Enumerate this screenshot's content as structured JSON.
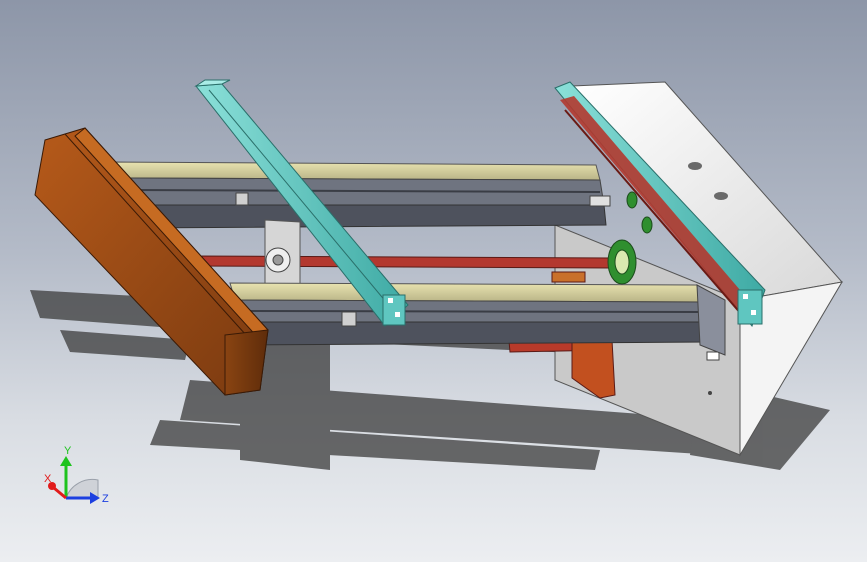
{
  "viewport": {
    "background_top": "#8d96a8",
    "background_bottom": "#eceef1"
  },
  "colors": {
    "wood_beam": "#9a4a14",
    "guide_plate": "#5fc6c0",
    "rail_steel": "#8a8f9c",
    "rail_rod": "#b3382f",
    "mount_plate": "#f2f2f2",
    "pulley_green": "#2f8f2f",
    "drive_bracket": "#c2501f"
  },
  "triad": {
    "x_label": "X",
    "y_label": "Y",
    "z_label": "Z",
    "x_color": "#e11b1b",
    "y_color": "#1ec31e",
    "z_color": "#1c3fe0"
  }
}
